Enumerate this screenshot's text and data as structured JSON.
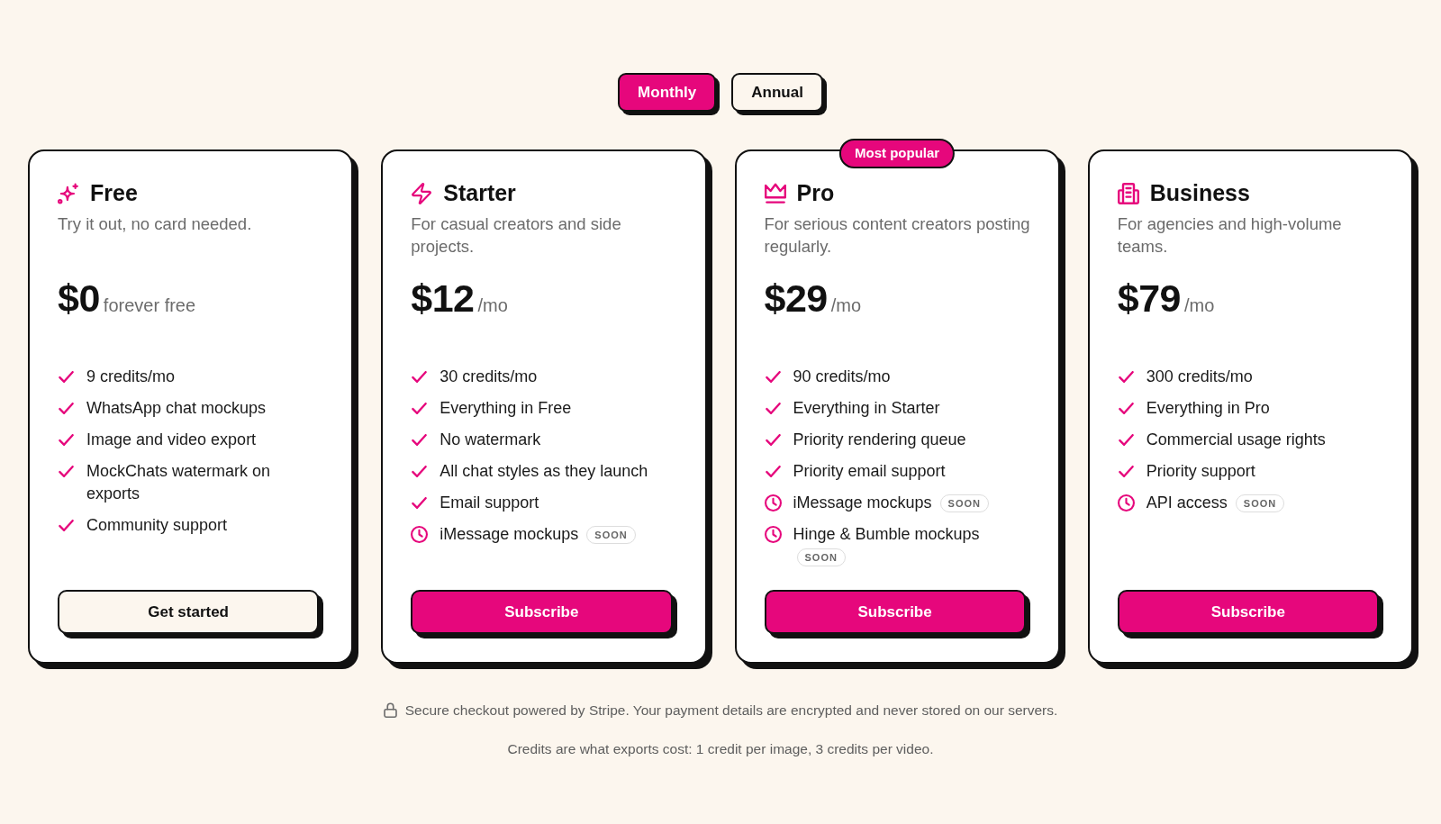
{
  "billing_toggle": [
    {
      "label": "Monthly",
      "selected": true
    },
    {
      "label": "Annual",
      "selected": false
    }
  ],
  "plans": [
    {
      "name": "Free",
      "description": "Try it out, no card needed.",
      "price": "$0",
      "period": "forever free",
      "features": [
        {
          "text": "9 credits/mo",
          "kind": "included"
        },
        {
          "text": "WhatsApp chat mockups",
          "kind": "included"
        },
        {
          "text": "Image and video export",
          "kind": "included"
        },
        {
          "text": "MockChats watermark on exports",
          "kind": "included"
        },
        {
          "text": "Community support",
          "kind": "included"
        }
      ],
      "button": {
        "label": "Get started",
        "kind": "secondary"
      }
    },
    {
      "name": "Starter",
      "description": "For casual creators and side projects.",
      "price": "$12",
      "period": "/mo",
      "features": [
        {
          "text": "30 credits/mo",
          "kind": "included"
        },
        {
          "text": "Everything in Free",
          "kind": "included"
        },
        {
          "text": "No watermark",
          "kind": "included"
        },
        {
          "text": "All chat styles as they launch",
          "kind": "included"
        },
        {
          "text": "Email support",
          "kind": "included"
        },
        {
          "text": "iMessage mockups",
          "kind": "soon",
          "badge": "SOON"
        }
      ],
      "button": {
        "label": "Subscribe",
        "kind": "primary"
      }
    },
    {
      "name": "Pro",
      "badge": "Most popular",
      "description": "For serious content creators posting regularly.",
      "price": "$29",
      "period": "/mo",
      "features": [
        {
          "text": "90 credits/mo",
          "kind": "included"
        },
        {
          "text": "Everything in Starter",
          "kind": "included"
        },
        {
          "text": "Priority rendering queue",
          "kind": "included"
        },
        {
          "text": "Priority email support",
          "kind": "included"
        },
        {
          "text": "iMessage mockups",
          "kind": "soon",
          "badge": "SOON"
        },
        {
          "text": "Hinge & Bumble mockups",
          "kind": "soon",
          "badge": "SOON"
        }
      ],
      "button": {
        "label": "Subscribe",
        "kind": "primary"
      }
    },
    {
      "name": "Business",
      "description": "For agencies and high-volume teams.",
      "price": "$79",
      "period": "/mo",
      "features": [
        {
          "text": "300 credits/mo",
          "kind": "included"
        },
        {
          "text": "Everything in Pro",
          "kind": "included"
        },
        {
          "text": "Commercial usage rights",
          "kind": "included"
        },
        {
          "text": "Priority support",
          "kind": "included"
        },
        {
          "text": "API access",
          "kind": "soon",
          "badge": "SOON"
        }
      ],
      "button": {
        "label": "Subscribe",
        "kind": "primary"
      }
    }
  ],
  "footer": {
    "security_note": "Secure checkout powered by Stripe. Your payment details are encrypted and never stored on our servers.",
    "credits_note": "Credits are what exports cost: 1 credit per image, 3 credits per video."
  }
}
